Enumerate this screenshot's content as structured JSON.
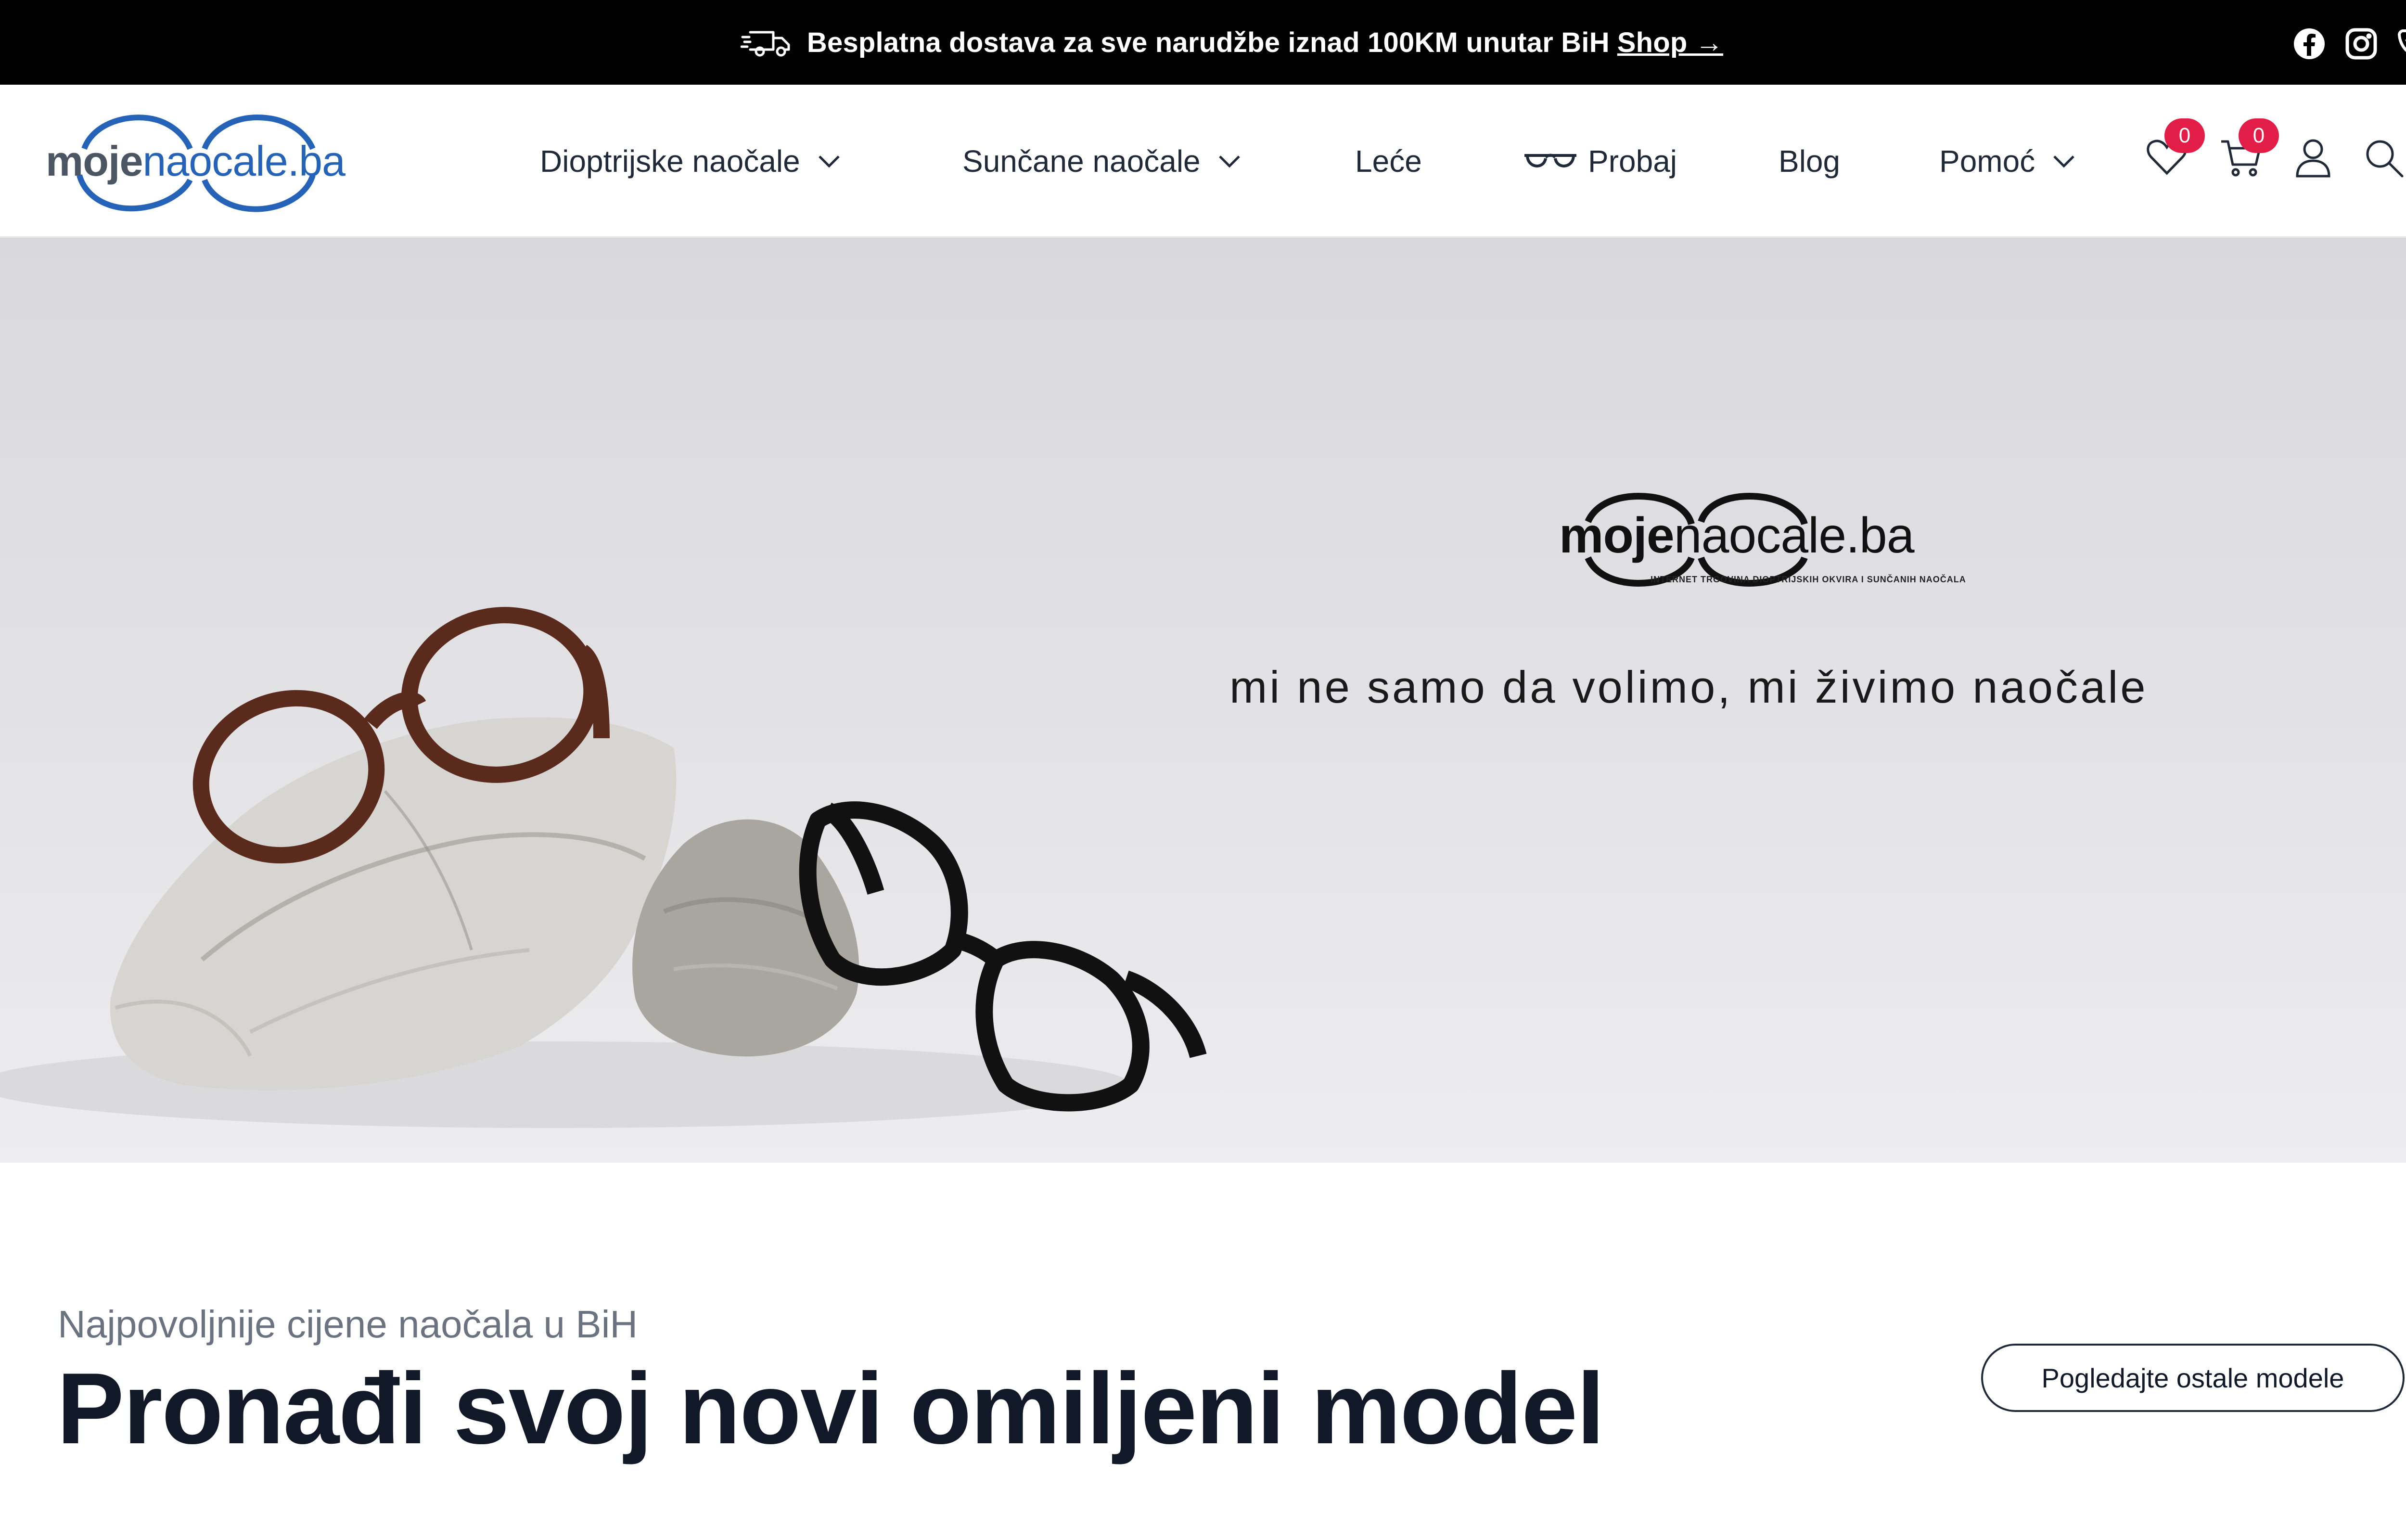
{
  "topbar": {
    "message": "Besplatna dostava za sve narudžbe iznad 100KM unutar BiH",
    "shop_link": "Shop →",
    "icons": [
      "truck-icon",
      "facebook-icon",
      "instagram-icon",
      "phone-icon"
    ]
  },
  "header": {
    "logo": {
      "bold": "moje",
      "light": "naocale.ba"
    },
    "nav": [
      {
        "label": "Dioptrijske naočale",
        "has_dropdown": true
      },
      {
        "label": "Sunčane naočale",
        "has_dropdown": true
      },
      {
        "label": "Leće",
        "has_dropdown": false
      },
      {
        "label": "Probaj",
        "has_dropdown": false,
        "icon": "glasses-icon"
      },
      {
        "label": "Blog",
        "has_dropdown": false
      },
      {
        "label": "Pomoć",
        "has_dropdown": true
      }
    ],
    "wishlist_count": "0",
    "cart_count": "0",
    "icons": [
      "heart-icon",
      "cart-icon",
      "user-icon",
      "search-icon"
    ]
  },
  "hero": {
    "brand_bold": "moje",
    "brand_light": "naocale.ba",
    "brand_sub": "INTERNET TRGOVINA DIOPTRIJSKIH OKVIRA I SUNČANIH NAOČALA",
    "tagline": "mi ne samo da volimo, mi živimo naočale"
  },
  "section": {
    "subtitle": "Najpovoljnije cijene naočala u BiH",
    "title": "Pronađi svoj novi omiljeni model",
    "cta": "Pogledajte ostale modele"
  },
  "colors": {
    "topbar_bg": "#000000",
    "brand_blue": "#2563b8",
    "badge_red": "#e11d48",
    "text_dark": "#111827"
  }
}
